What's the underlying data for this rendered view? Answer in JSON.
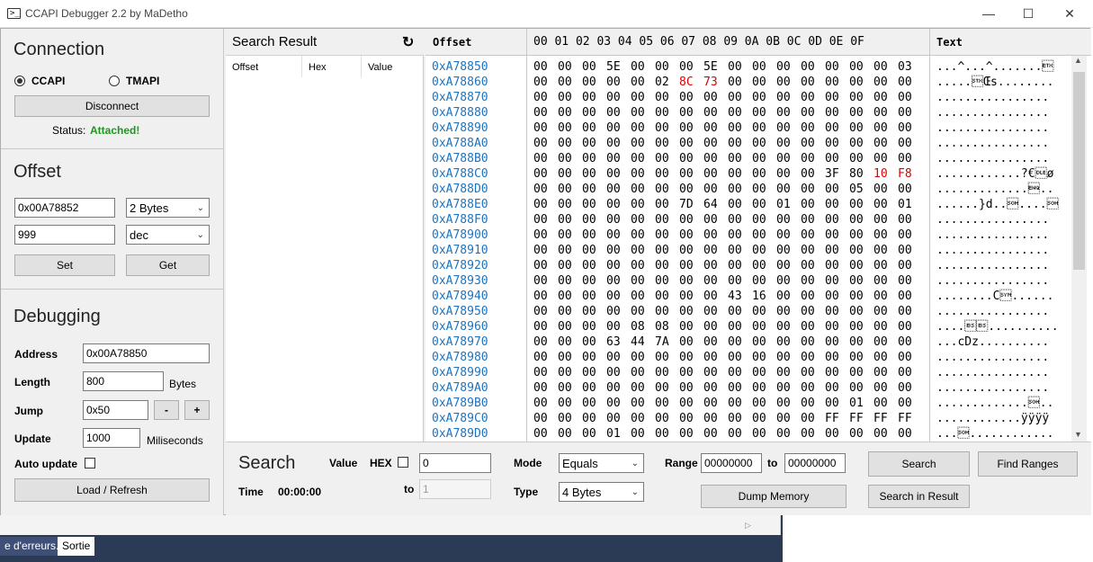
{
  "window": {
    "title": "CCAPI Debugger 2.2 by MaDetho",
    "minimize": "—",
    "maximize": "☐",
    "close": "✕"
  },
  "connection": {
    "title": "Connection",
    "option_ccapi": "CCAPI",
    "option_tmapi": "TMAPI",
    "selected": "CCAPI",
    "disconnect_label": "Disconnect",
    "status_label": "Status:",
    "status_value": "Attached!",
    "status_color": "#1a9a1a"
  },
  "offset": {
    "title": "Offset",
    "address_value": "0x00A78852",
    "size_value": "2 Bytes",
    "value_value": "999",
    "format_value": "dec",
    "set_label": "Set",
    "get_label": "Get"
  },
  "debugging": {
    "title": "Debugging",
    "address_label": "Address",
    "address_value": "0x00A78850",
    "length_label": "Length",
    "length_value": "800",
    "length_unit": "Bytes",
    "jump_label": "Jump",
    "jump_value": "0x50",
    "jump_minus": "-",
    "jump_plus": "+",
    "update_label": "Update",
    "update_value": "1000",
    "update_unit": "Miliseconds",
    "auto_update_label": "Auto update",
    "load_label": "Load / Refresh"
  },
  "search_result": {
    "title": "Search Result",
    "refresh_icon": "refresh-icon",
    "columns": [
      "Offset",
      "Hex",
      "Value"
    ]
  },
  "hex_view": {
    "offset_header": "Offset",
    "column_headers": "00 01 02 03 04 05 06 07 08 09 0A 0B 0C 0D 0E 0F",
    "text_header": "Text",
    "rows": [
      {
        "addr": "0xA78850",
        "hex": [
          "00",
          "00",
          "00",
          "5E",
          "00",
          "00",
          "00",
          "5E",
          "00",
          "00",
          "00",
          "00",
          "00",
          "00",
          "00",
          "03"
        ],
        "text": "...^...^.......\u0003"
      },
      {
        "addr": "0xA78860",
        "hex": [
          "00",
          "00",
          "00",
          "00",
          "00",
          "02",
          "8C",
          "73",
          "00",
          "00",
          "00",
          "00",
          "00",
          "00",
          "00",
          "00"
        ],
        "text": ".....\u0002Œs........"
      },
      {
        "addr": "0xA78870",
        "hex": [
          "00",
          "00",
          "00",
          "00",
          "00",
          "00",
          "00",
          "00",
          "00",
          "00",
          "00",
          "00",
          "00",
          "00",
          "00",
          "00"
        ],
        "text": "................"
      },
      {
        "addr": "0xA78880",
        "hex": [
          "00",
          "00",
          "00",
          "00",
          "00",
          "00",
          "00",
          "00",
          "00",
          "00",
          "00",
          "00",
          "00",
          "00",
          "00",
          "00"
        ],
        "text": "................"
      },
      {
        "addr": "0xA78890",
        "hex": [
          "00",
          "00",
          "00",
          "00",
          "00",
          "00",
          "00",
          "00",
          "00",
          "00",
          "00",
          "00",
          "00",
          "00",
          "00",
          "00"
        ],
        "text": "................"
      },
      {
        "addr": "0xA788A0",
        "hex": [
          "00",
          "00",
          "00",
          "00",
          "00",
          "00",
          "00",
          "00",
          "00",
          "00",
          "00",
          "00",
          "00",
          "00",
          "00",
          "00"
        ],
        "text": "................"
      },
      {
        "addr": "0xA788B0",
        "hex": [
          "00",
          "00",
          "00",
          "00",
          "00",
          "00",
          "00",
          "00",
          "00",
          "00",
          "00",
          "00",
          "00",
          "00",
          "00",
          "00"
        ],
        "text": "................"
      },
      {
        "addr": "0xA788C0",
        "hex": [
          "00",
          "00",
          "00",
          "00",
          "00",
          "00",
          "00",
          "00",
          "00",
          "00",
          "00",
          "00",
          "3F",
          "80",
          "10",
          "F8"
        ],
        "text": "............?€\u0010ø"
      },
      {
        "addr": "0xA788D0",
        "hex": [
          "00",
          "00",
          "00",
          "00",
          "00",
          "00",
          "00",
          "00",
          "00",
          "00",
          "00",
          "00",
          "00",
          "05",
          "00",
          "00"
        ],
        "text": ".............\u0005.."
      },
      {
        "addr": "0xA788E0",
        "hex": [
          "00",
          "00",
          "00",
          "00",
          "00",
          "00",
          "7D",
          "64",
          "00",
          "00",
          "01",
          "00",
          "00",
          "00",
          "00",
          "01"
        ],
        "text": "......}d..\u0001....\u0001"
      },
      {
        "addr": "0xA788F0",
        "hex": [
          "00",
          "00",
          "00",
          "00",
          "00",
          "00",
          "00",
          "00",
          "00",
          "00",
          "00",
          "00",
          "00",
          "00",
          "00",
          "00"
        ],
        "text": "................"
      },
      {
        "addr": "0xA78900",
        "hex": [
          "00",
          "00",
          "00",
          "00",
          "00",
          "00",
          "00",
          "00",
          "00",
          "00",
          "00",
          "00",
          "00",
          "00",
          "00",
          "00"
        ],
        "text": "................"
      },
      {
        "addr": "0xA78910",
        "hex": [
          "00",
          "00",
          "00",
          "00",
          "00",
          "00",
          "00",
          "00",
          "00",
          "00",
          "00",
          "00",
          "00",
          "00",
          "00",
          "00"
        ],
        "text": "................"
      },
      {
        "addr": "0xA78920",
        "hex": [
          "00",
          "00",
          "00",
          "00",
          "00",
          "00",
          "00",
          "00",
          "00",
          "00",
          "00",
          "00",
          "00",
          "00",
          "00",
          "00"
        ],
        "text": "................"
      },
      {
        "addr": "0xA78930",
        "hex": [
          "00",
          "00",
          "00",
          "00",
          "00",
          "00",
          "00",
          "00",
          "00",
          "00",
          "00",
          "00",
          "00",
          "00",
          "00",
          "00"
        ],
        "text": "................"
      },
      {
        "addr": "0xA78940",
        "hex": [
          "00",
          "00",
          "00",
          "00",
          "00",
          "00",
          "00",
          "00",
          "43",
          "16",
          "00",
          "00",
          "00",
          "00",
          "00",
          "00"
        ],
        "text": "........C\u0016......"
      },
      {
        "addr": "0xA78950",
        "hex": [
          "00",
          "00",
          "00",
          "00",
          "00",
          "00",
          "00",
          "00",
          "00",
          "00",
          "00",
          "00",
          "00",
          "00",
          "00",
          "00"
        ],
        "text": "................"
      },
      {
        "addr": "0xA78960",
        "hex": [
          "00",
          "00",
          "00",
          "00",
          "08",
          "08",
          "00",
          "00",
          "00",
          "00",
          "00",
          "00",
          "00",
          "00",
          "00",
          "00"
        ],
        "text": "....\b\b.........."
      },
      {
        "addr": "0xA78970",
        "hex": [
          "00",
          "00",
          "00",
          "63",
          "44",
          "7A",
          "00",
          "00",
          "00",
          "00",
          "00",
          "00",
          "00",
          "00",
          "00",
          "00"
        ],
        "text": "...cDz.........."
      },
      {
        "addr": "0xA78980",
        "hex": [
          "00",
          "00",
          "00",
          "00",
          "00",
          "00",
          "00",
          "00",
          "00",
          "00",
          "00",
          "00",
          "00",
          "00",
          "00",
          "00"
        ],
        "text": "................"
      },
      {
        "addr": "0xA78990",
        "hex": [
          "00",
          "00",
          "00",
          "00",
          "00",
          "00",
          "00",
          "00",
          "00",
          "00",
          "00",
          "00",
          "00",
          "00",
          "00",
          "00"
        ],
        "text": "................"
      },
      {
        "addr": "0xA789A0",
        "hex": [
          "00",
          "00",
          "00",
          "00",
          "00",
          "00",
          "00",
          "00",
          "00",
          "00",
          "00",
          "00",
          "00",
          "00",
          "00",
          "00"
        ],
        "text": "................"
      },
      {
        "addr": "0xA789B0",
        "hex": [
          "00",
          "00",
          "00",
          "00",
          "00",
          "00",
          "00",
          "00",
          "00",
          "00",
          "00",
          "00",
          "00",
          "01",
          "00",
          "00"
        ],
        "text": ".............\u0001.."
      },
      {
        "addr": "0xA789C0",
        "hex": [
          "00",
          "00",
          "00",
          "00",
          "00",
          "00",
          "00",
          "00",
          "00",
          "00",
          "00",
          "00",
          "FF",
          "FF",
          "FF",
          "FF"
        ],
        "text": "............ÿÿÿÿ"
      },
      {
        "addr": "0xA789D0",
        "hex": [
          "00",
          "00",
          "00",
          "01",
          "00",
          "00",
          "00",
          "00",
          "00",
          "00",
          "00",
          "00",
          "00",
          "00",
          "00",
          "00"
        ],
        "text": "...\u0001............"
      }
    ],
    "highlight_color": "#e00000",
    "address_color": "#1e73be"
  },
  "search": {
    "title": "Search",
    "time_label": "Time",
    "time_value": "00:00:00",
    "value_label": "Value",
    "hex_label": "HEX",
    "value_input": "0",
    "to_label": "to",
    "to_input": "1",
    "mode_label": "Mode",
    "mode_value": "Equals",
    "type_label": "Type",
    "type_value": "4 Bytes",
    "range_label": "Range",
    "range_from": "00000000",
    "range_to_label": "to",
    "range_to": "00000000",
    "search_button": "Search",
    "find_ranges_button": "Find Ranges",
    "dump_memory_button": "Dump Memory",
    "search_in_result_button": "Search in Result"
  },
  "taskbar": {
    "tab_errors": "e d'erreurs...",
    "tab_output": "Sortie",
    "scroll_arrow": "▷"
  }
}
